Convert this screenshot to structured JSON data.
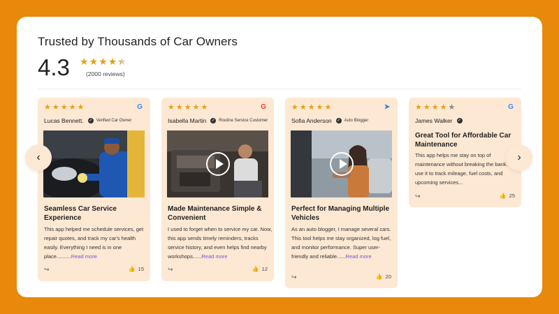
{
  "header": {
    "title": "Trusted by Thousands of Car Owners",
    "rating": "4.3",
    "rating_value": 4.3,
    "reviews_label": "(2000 reviews)"
  },
  "colors": {
    "page_background": "#E8890B",
    "card_background": "#FDE8D3",
    "star": "#E5A019",
    "read_more": "#7B4CE0"
  },
  "nav": {
    "prev_icon": "chevron-left-icon",
    "next_icon": "chevron-right-icon"
  },
  "reviews": [
    {
      "stars": 5,
      "source_icon": "google-icon",
      "name": "Lucas Bennett.",
      "role": "Verified Car Owner",
      "media": "photo",
      "title": "Seamless Car Service Experience",
      "text": "This app helped me schedule services, get repair quotes, and track my car's health easily. Everything I need is in one place..........",
      "read_more": "Read more",
      "likes": "15"
    },
    {
      "stars": 5,
      "source_icon": "g2-icon",
      "name": "Isabella Martin",
      "role": "Routine Service Customer",
      "media": "video",
      "title": "Made Maintenance Simple & Convenient",
      "text": "I used to forget when to service my car. Now, this app sends timely reminders, tracks service history, and even helps find nearby workshops......",
      "read_more": "Read more",
      "likes": "12"
    },
    {
      "stars": 5,
      "source_icon": "capterra-icon",
      "name": "Sofia Anderson",
      "role": "Auto Blogger",
      "media": "video",
      "title": "Perfect for Managing Multiple Vehicles",
      "text": "As an auto blogger, I manage several cars. This tool helps me stay organized, log fuel, and monitor performance. Super user-friendly and reliable......",
      "read_more": "Read more",
      "likes": "20"
    },
    {
      "stars": 4,
      "source_icon": "google-icon",
      "name": "James Walker",
      "role": "",
      "media": "none",
      "title": "Great Tool for Affordable Car Maintenance",
      "text": "This app helps me stay on top of maintenance without breaking the bank. I use it to track mileage, fuel costs, and upcoming services...",
      "read_more": "",
      "likes": "25"
    }
  ]
}
